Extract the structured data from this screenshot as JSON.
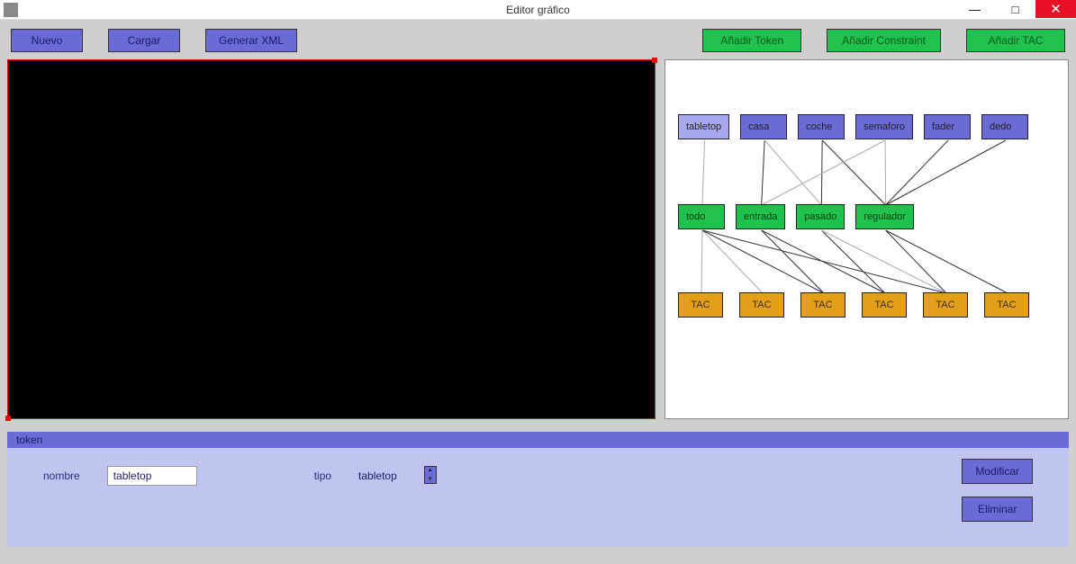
{
  "window": {
    "title": "Editor gráfico"
  },
  "toolbar": {
    "nuevo": "Nuevo",
    "cargar": "Cargar",
    "generar_xml": "Generar XML",
    "anadir_token": "Añadir Token",
    "anadir_constraint": "Añadir Constraint",
    "anadir_tac": "Añadir TAC"
  },
  "graph": {
    "tokens": [
      "tabletop",
      "casa",
      "coche",
      "semaforo",
      "fader",
      "dedo"
    ],
    "constraints": [
      "todo",
      "entrada",
      "pasado",
      "regulador"
    ],
    "tacs": [
      "TAC",
      "TAC",
      "TAC",
      "TAC",
      "TAC",
      "TAC"
    ],
    "edges": [
      {
        "from": "token.0",
        "to": "constraint.0"
      },
      {
        "from": "token.1",
        "to": "constraint.1"
      },
      {
        "from": "token.1",
        "to": "constraint.2"
      },
      {
        "from": "token.2",
        "to": "constraint.2"
      },
      {
        "from": "token.2",
        "to": "constraint.3"
      },
      {
        "from": "token.3",
        "to": "constraint.1"
      },
      {
        "from": "token.3",
        "to": "constraint.3"
      },
      {
        "from": "token.4",
        "to": "constraint.3"
      },
      {
        "from": "token.5",
        "to": "constraint.3"
      },
      {
        "from": "constraint.0",
        "to": "tac.0"
      },
      {
        "from": "constraint.0",
        "to": "tac.1"
      },
      {
        "from": "constraint.0",
        "to": "tac.2"
      },
      {
        "from": "constraint.0",
        "to": "tac.4"
      },
      {
        "from": "constraint.1",
        "to": "tac.2"
      },
      {
        "from": "constraint.1",
        "to": "tac.3"
      },
      {
        "from": "constraint.2",
        "to": "tac.3"
      },
      {
        "from": "constraint.2",
        "to": "tac.4"
      },
      {
        "from": "constraint.3",
        "to": "tac.4"
      },
      {
        "from": "constraint.3",
        "to": "tac.5"
      }
    ]
  },
  "footer": {
    "section": "token",
    "nombre_label": "nombre",
    "nombre_value": "tabletop",
    "tipo_label": "tipo",
    "tipo_value": "tabletop",
    "modificar": "Modificar",
    "eliminar": "Eliminar"
  }
}
